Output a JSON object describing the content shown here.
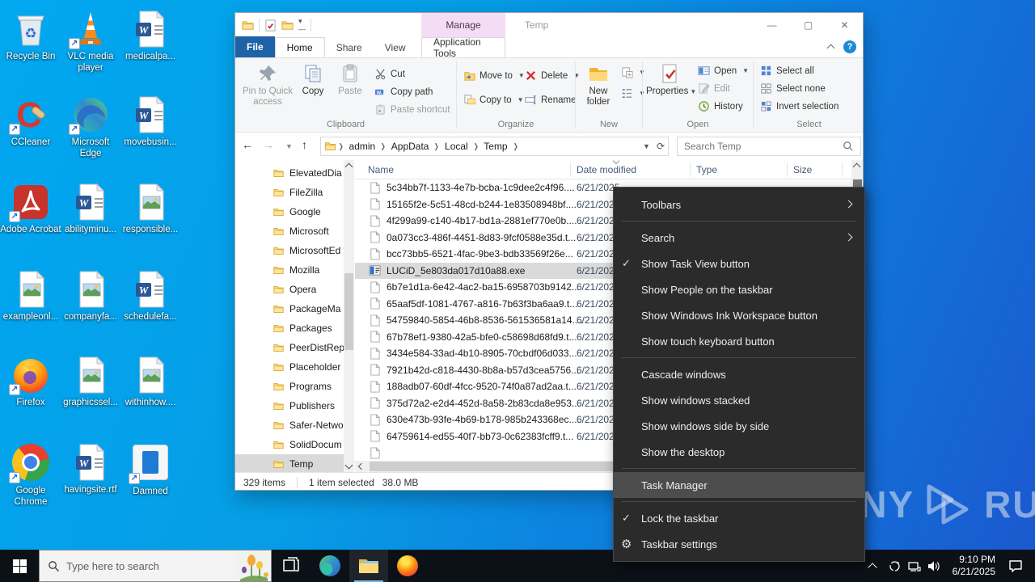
{
  "desktop": {
    "icons": [
      {
        "label": "Recycle Bin",
        "kind": "recycle",
        "shortcut": false
      },
      {
        "label": "VLC media player",
        "kind": "vlc",
        "shortcut": true
      },
      {
        "label": "medicalpa...",
        "kind": "word",
        "shortcut": false
      },
      {
        "label": "CCleaner",
        "kind": "ccleaner",
        "shortcut": true
      },
      {
        "label": "Microsoft Edge",
        "kind": "edge",
        "shortcut": true
      },
      {
        "label": "movebusin...",
        "kind": "word",
        "shortcut": false
      },
      {
        "label": "Adobe Acrobat",
        "kind": "acrobat",
        "shortcut": true
      },
      {
        "label": "abilityminu...",
        "kind": "word",
        "shortcut": false
      },
      {
        "label": "responsible...",
        "kind": "image",
        "shortcut": false
      },
      {
        "label": "exampleonl...",
        "kind": "image",
        "shortcut": false
      },
      {
        "label": "companyfa...",
        "kind": "image",
        "shortcut": false
      },
      {
        "label": "schedulefa...",
        "kind": "word",
        "shortcut": false
      },
      {
        "label": "Firefox",
        "kind": "firefox",
        "shortcut": true
      },
      {
        "label": "graphicssel...",
        "kind": "image",
        "shortcut": false
      },
      {
        "label": "withinhow....",
        "kind": "image",
        "shortcut": false
      },
      {
        "label": "Google Chrome",
        "kind": "chrome",
        "shortcut": true
      },
      {
        "label": "havingsite.rtf",
        "kind": "word",
        "shortcut": false
      },
      {
        "label": "Damned",
        "kind": "appblue",
        "shortcut": true
      }
    ]
  },
  "explorer": {
    "window_title": "Temp",
    "manage_tab": "Manage",
    "tabs": {
      "file": "File",
      "home": "Home",
      "share": "Share",
      "view": "View",
      "app_tools": "Application Tools"
    },
    "ribbon": {
      "pin": "Pin to Quick access",
      "copy": "Copy",
      "paste": "Paste",
      "cut": "Cut",
      "copy_path": "Copy path",
      "paste_shortcut": "Paste shortcut",
      "move_to": "Move to",
      "copy_to": "Copy to",
      "delete": "Delete",
      "rename": "Rename",
      "new_folder": "New folder",
      "properties": "Properties",
      "open": "Open",
      "edit": "Edit",
      "history": "History",
      "select_all": "Select all",
      "select_none": "Select none",
      "invert_selection": "Invert selection",
      "groups": {
        "clipboard": "Clipboard",
        "organize": "Organize",
        "new": "New",
        "open": "Open",
        "select": "Select"
      }
    },
    "address": {
      "crumbs": [
        "admin",
        "AppData",
        "Local",
        "Temp"
      ],
      "search_placeholder": "Search Temp"
    },
    "columns": {
      "name": "Name",
      "date": "Date modified",
      "type": "Type",
      "size": "Size"
    },
    "sidebar": {
      "items": [
        "ElevatedDia",
        "FileZilla",
        "Google",
        "Microsoft",
        "MicrosoftEd",
        "Mozilla",
        "Opera",
        "PackageMa",
        "Packages",
        "PeerDistRep",
        "Placeholder",
        "Programs",
        "Publishers",
        "Safer-Netwo",
        "SolidDocum",
        "Temp"
      ],
      "selected_index": 15
    },
    "files": [
      {
        "name": "5c34bb7f-1133-4e7b-bcba-1c9dee2c4f96....",
        "date": "6/21/2025",
        "kind": "file",
        "selected": false
      },
      {
        "name": "15165f2e-5c51-48cd-b244-1e83508948bf....",
        "date": "6/21/2025",
        "kind": "file",
        "selected": false
      },
      {
        "name": "4f299a99-c140-4b17-bd1a-2881ef770e0b....",
        "date": "6/21/2025",
        "kind": "file",
        "selected": false
      },
      {
        "name": "0a073cc3-486f-4451-8d83-9fcf0588e35d.t...",
        "date": "6/21/2025",
        "kind": "file",
        "selected": false
      },
      {
        "name": "bcc73bb5-6521-4fac-9be3-bdb33569f26e...",
        "date": "6/21/2025",
        "kind": "file",
        "selected": false
      },
      {
        "name": "LUCiD_5e803da017d10a88.exe",
        "date": "6/21/2025",
        "kind": "exe",
        "selected": true
      },
      {
        "name": "6b7e1d1a-6e42-4ac2-ba15-6958703b9142...",
        "date": "6/21/2025",
        "kind": "file",
        "selected": false
      },
      {
        "name": "65aaf5df-1081-4767-a816-7b63f3ba6aa9.t...",
        "date": "6/21/2025",
        "kind": "file",
        "selected": false
      },
      {
        "name": "54759840-5854-46b8-8536-561536581a14....",
        "date": "6/21/2025",
        "kind": "file",
        "selected": false
      },
      {
        "name": "67b78ef1-9380-42a5-bfe0-c58698d68fd9.t...",
        "date": "6/21/2025",
        "kind": "file",
        "selected": false
      },
      {
        "name": "3434e584-33ad-4b10-8905-70cbdf06d033...",
        "date": "6/21/2025",
        "kind": "file",
        "selected": false
      },
      {
        "name": "7921b42d-c818-4430-8b8a-b57d3cea5756...",
        "date": "6/21/2025",
        "kind": "file",
        "selected": false
      },
      {
        "name": "188adb07-60df-4fcc-9520-74f0a87ad2aa.t...",
        "date": "6/21/2025",
        "kind": "file",
        "selected": false
      },
      {
        "name": "375d72a2-e2d4-452d-8a58-2b83cda8e953...",
        "date": "6/21/2025",
        "kind": "file",
        "selected": false
      },
      {
        "name": "630e473b-93fe-4b69-b178-985b243368ec....",
        "date": "6/21/2025",
        "kind": "file",
        "selected": false
      },
      {
        "name": "64759614-ed55-40f7-bb73-0c62383fcff9.t...",
        "date": "6/21/2025",
        "kind": "file",
        "selected": false
      }
    ],
    "status": {
      "items": "329 items",
      "selected": "1 item selected",
      "size": "38.0 MB"
    }
  },
  "context_menu": {
    "items": [
      {
        "label": "Toolbars",
        "submenu": true
      },
      {
        "sep": true
      },
      {
        "label": "Search",
        "submenu": true
      },
      {
        "label": "Show Task View button",
        "checked": true
      },
      {
        "label": "Show People on the taskbar"
      },
      {
        "label": "Show Windows Ink Workspace button"
      },
      {
        "label": "Show touch keyboard button"
      },
      {
        "sep": true
      },
      {
        "label": "Cascade windows"
      },
      {
        "label": "Show windows stacked"
      },
      {
        "label": "Show windows side by side"
      },
      {
        "label": "Show the desktop"
      },
      {
        "sep": true
      },
      {
        "label": "Task Manager",
        "highlighted": true
      },
      {
        "sep": true
      },
      {
        "label": "Lock the taskbar",
        "checked": true
      },
      {
        "label": "Taskbar settings",
        "gear": true
      }
    ]
  },
  "taskbar": {
    "search_placeholder": "Type here to search",
    "clock_time": "9:10 PM",
    "clock_date": "6/21/2025"
  },
  "watermark": {
    "left": "ANY",
    "right": "RUN"
  },
  "colors": {
    "accent": "#1e62a8",
    "manage_tab": "#f5dcf5",
    "menu_bg": "#2b2b2b",
    "menu_highlight": "#4d4d4d",
    "taskbar": "#0c1118",
    "selection": "#dadada"
  }
}
